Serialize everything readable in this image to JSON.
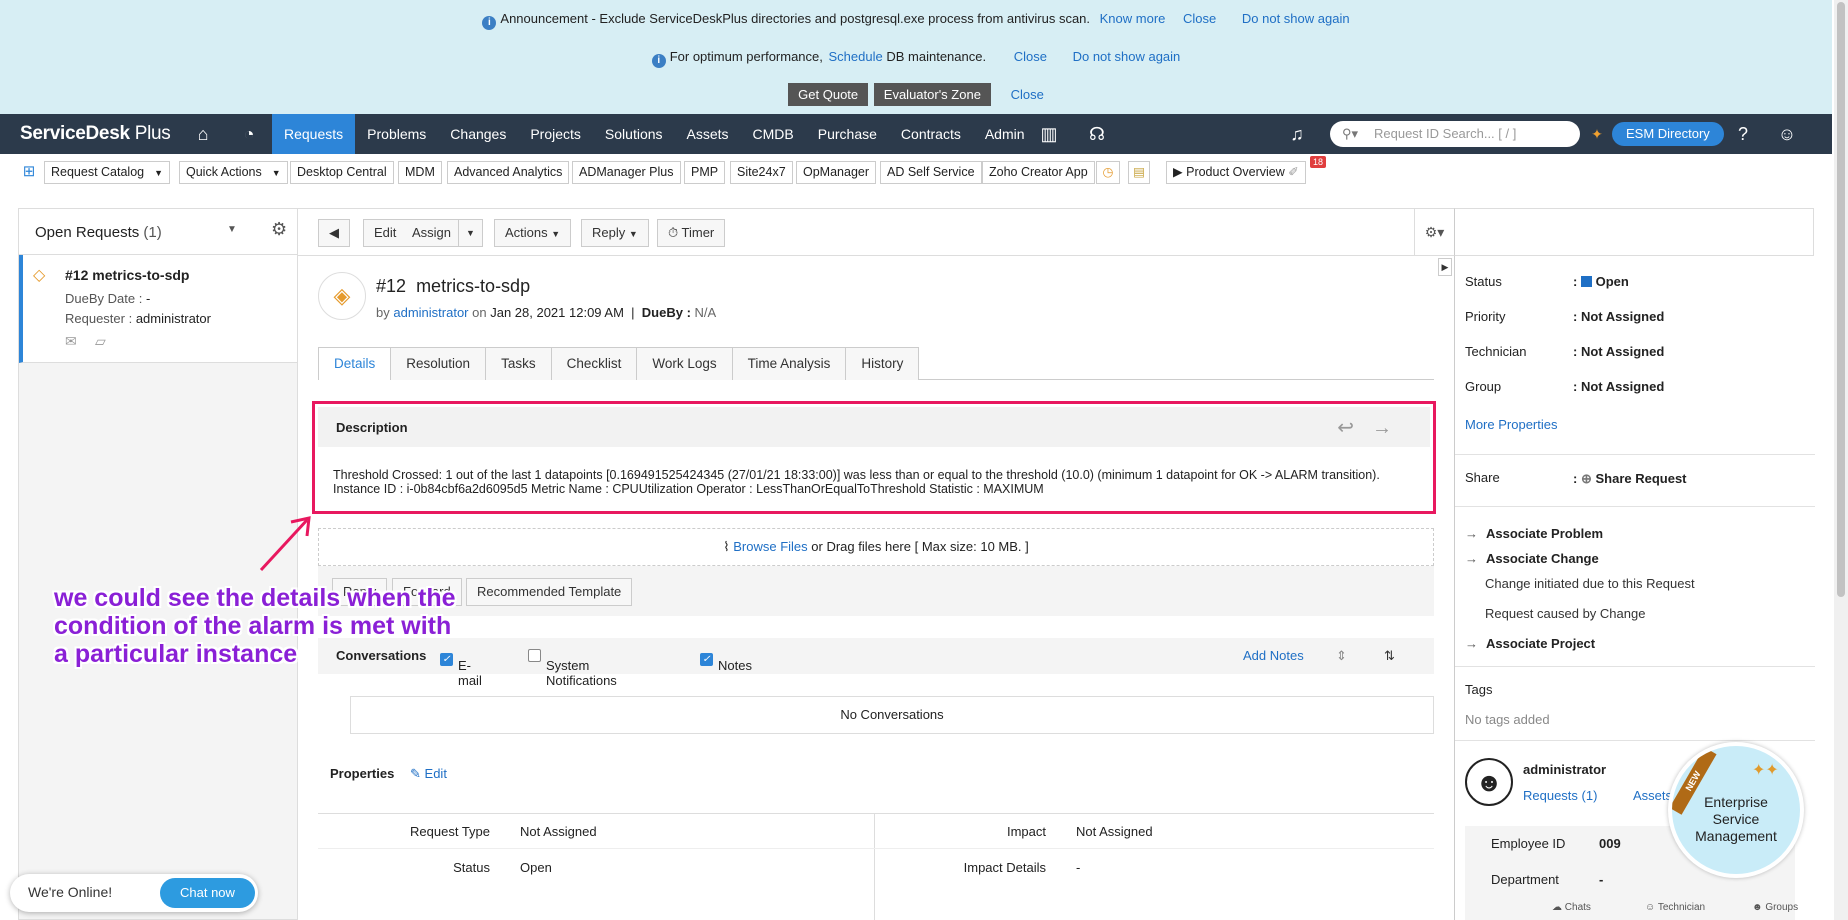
{
  "announcement": {
    "line1_text": "Announcement - Exclude ServiceDeskPlus directories and postgresql.exe process from antivirus scan.",
    "line1_know_more": "Know more",
    "line1_close": "Close",
    "line1_dont_show": "Do not show again",
    "line2_prefix": "For optimum performance,",
    "line2_link": "Schedule",
    "line2_suffix": "DB maintenance.",
    "line2_close": "Close",
    "line2_dont_show": "Do not show again",
    "get_quote": "Get Quote",
    "evaluators_zone": "Evaluator's Zone",
    "line3_close": "Close"
  },
  "nav": {
    "logo": "ServiceDesk",
    "logo_plus": "Plus",
    "menu": [
      "Requests",
      "Problems",
      "Changes",
      "Projects",
      "Solutions",
      "Assets",
      "CMDB",
      "Purchase",
      "Contracts",
      "Admin"
    ],
    "active": "Requests",
    "search_placeholder": "Request ID Search... [ / ]",
    "esm_directory": "ESM Directory"
  },
  "toolbar": {
    "items": [
      "Request Catalog",
      "Quick Actions",
      "Desktop Central",
      "MDM",
      "Advanced Analytics",
      "ADManager Plus",
      "PMP",
      "Site24x7",
      "OpManager",
      "AD Self Service",
      "Zoho Creator App",
      "Product Overview"
    ],
    "badge_count": "18"
  },
  "left_panel": {
    "title": "Open Requests",
    "count": "(1)",
    "item": {
      "title": "#12 metrics-to-sdp",
      "dueby_label": "DueBy Date :",
      "dueby_value": "-",
      "requester_label": "Requester :",
      "requester_value": "administrator"
    }
  },
  "center_bar": {
    "edit": "Edit",
    "assign": "Assign",
    "actions": "Actions",
    "reply": "Reply",
    "timer": "Timer"
  },
  "request": {
    "id": "#12",
    "subject": "metrics-to-sdp",
    "by_label": "by",
    "by_user": "administrator",
    "on_label": "on",
    "date": "Jan 28, 2021 12:09 AM",
    "sep": "|",
    "dueby_label": "DueBy :",
    "dueby_value": "N/A"
  },
  "tabs": [
    "Details",
    "Resolution",
    "Tasks",
    "Checklist",
    "Work Logs",
    "Time Analysis",
    "History"
  ],
  "description": {
    "title": "Description",
    "text": "Threshold Crossed: 1 out of the last 1 datapoints [0.169491525424345 (27/01/21 18:33:00)] was less than or equal to the threshold (10.0) (minimum 1 datapoint for OK -> ALARM transition). Instance ID : i-0b84cbf6a2d6095d5 Metric Name : CPUUtilization Operator : LessThanOrEqualToThreshold Statistic : MAXIMUM"
  },
  "attach": {
    "link": "Browse Files",
    "text": "or Drag files here [ Max size: 10 MB. ]"
  },
  "reply_row": {
    "reply": "Reply",
    "forward": "Forward",
    "template": "Recommended Template"
  },
  "conversations": {
    "label": "Conversations",
    "email": "E-mail",
    "system": "System Notifications",
    "notes": "Notes",
    "add_notes": "Add Notes",
    "empty": "No Conversations"
  },
  "properties": {
    "title": "Properties",
    "edit": "Edit",
    "rows": [
      {
        "l1": "Request Type",
        "v1": "Not Assigned",
        "l2": "Impact",
        "v2": "Not Assigned"
      },
      {
        "l1": "Status",
        "v1": "Open",
        "l2": "Impact Details",
        "v2": "-"
      }
    ]
  },
  "right_panel": {
    "status_label": "Status",
    "status_value": "Open",
    "priority_label": "Priority",
    "priority_value": "Not Assigned",
    "technician_label": "Technician",
    "technician_value": "Not Assigned",
    "group_label": "Group",
    "group_value": "Not Assigned",
    "more_properties": "More Properties",
    "share_label": "Share",
    "share_value": "Share Request",
    "associate_problem": "Associate Problem",
    "associate_change": "Associate Change",
    "change_initiated": "Change initiated due to this Request",
    "request_caused": "Request caused by Change",
    "associate_project": "Associate Project",
    "tags_label": "Tags",
    "tags_value": "No tags added",
    "user_name": "administrator",
    "user_requests": "Requests (1)",
    "user_assets": "Assets",
    "employee_id_label": "Employee ID",
    "employee_id_value": "009",
    "department_label": "Department",
    "department_value": "-"
  },
  "annotation": {
    "line1": "we could see the details when the",
    "line2": "condition of the alarm is met with",
    "line3": "a particular instance"
  },
  "chat": {
    "text": "We're Online!",
    "button": "Chat now"
  },
  "esm_badge": {
    "new": "NEW",
    "line1": "Enterprise",
    "line2": "Service",
    "line3": "Management"
  },
  "bottom_icons": [
    "Chats",
    "Technician",
    "Groups"
  ],
  "colors": {
    "accent": "#2d85d8",
    "nav_bg": "#2c3a4b",
    "highlight": "#e8185f",
    "annotation": "#8a20d6"
  }
}
